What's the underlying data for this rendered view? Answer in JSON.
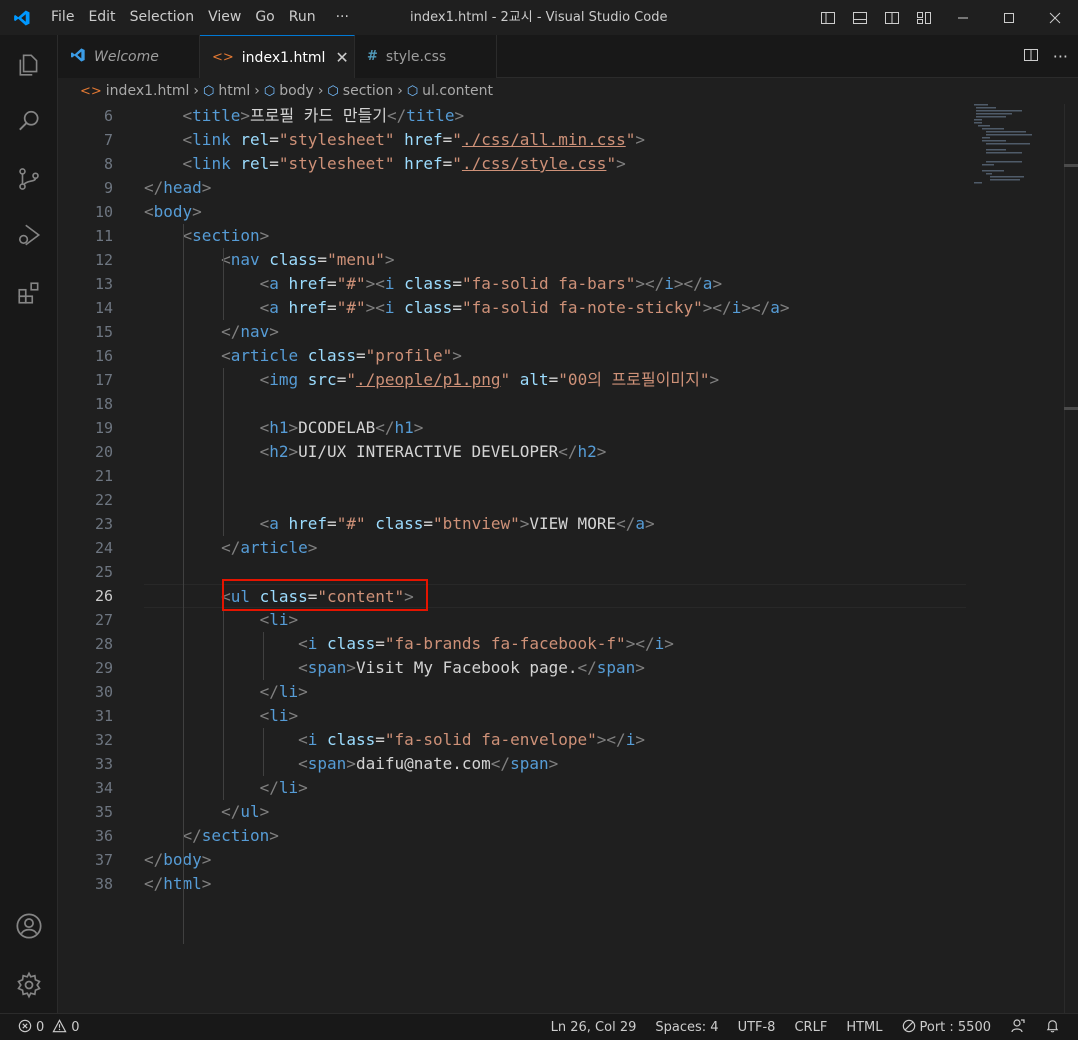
{
  "menu": [
    "File",
    "Edit",
    "Selection",
    "View",
    "Go",
    "Run",
    "···"
  ],
  "window_title": "index1.html - 2교시 - Visual Studio Code",
  "tabs": [
    {
      "label": "Welcome",
      "icon": "vscode-logo-icon",
      "italic": true,
      "active": false
    },
    {
      "label": "index1.html",
      "icon": "html-file-icon",
      "italic": false,
      "active": true
    },
    {
      "label": "style.css",
      "icon": "css-file-icon",
      "italic": false,
      "active": false
    }
  ],
  "breadcrumb": [
    "index1.html",
    "html",
    "body",
    "section",
    "ul.content"
  ],
  "lines": [
    {
      "n": "6",
      "html": "    <span class=\"punc\">&lt;</span><span class=\"tag\">title</span><span class=\"punc\">&gt;</span><span class=\"txt\">프로필 카드 만들기</span><span class=\"punc\">&lt;/</span><span class=\"tag\">title</span><span class=\"punc\">&gt;</span>"
    },
    {
      "n": "7",
      "html": "    <span class=\"punc\">&lt;</span><span class=\"tag\">link</span> <span class=\"attr\">rel</span><span class=\"txt\">=</span><span class=\"str\">\"stylesheet\"</span> <span class=\"attr\">href</span><span class=\"txt\">=</span><span class=\"str\">\"<span class=\"link\">./css/all.min.css</span>\"</span><span class=\"punc\">&gt;</span>"
    },
    {
      "n": "8",
      "html": "    <span class=\"punc\">&lt;</span><span class=\"tag\">link</span> <span class=\"attr\">rel</span><span class=\"txt\">=</span><span class=\"str\">\"stylesheet\"</span> <span class=\"attr\">href</span><span class=\"txt\">=</span><span class=\"str\">\"<span class=\"link\">./css/style.css</span>\"</span><span class=\"punc\">&gt;</span>"
    },
    {
      "n": "9",
      "html": "<span class=\"punc\">&lt;/</span><span class=\"tag\">head</span><span class=\"punc\">&gt;</span>"
    },
    {
      "n": "10",
      "html": "<span class=\"punc\">&lt;</span><span class=\"tag\">body</span><span class=\"punc\">&gt;</span>"
    },
    {
      "n": "11",
      "html": "    <span class=\"punc\">&lt;</span><span class=\"tag\">section</span><span class=\"punc\">&gt;</span>"
    },
    {
      "n": "12",
      "html": "        <span class=\"punc\">&lt;</span><span class=\"tag\">nav</span> <span class=\"attr\">class</span><span class=\"txt\">=</span><span class=\"str\">\"menu\"</span><span class=\"punc\">&gt;</span>"
    },
    {
      "n": "13",
      "html": "            <span class=\"punc\">&lt;</span><span class=\"tag\">a</span> <span class=\"attr\">href</span><span class=\"txt\">=</span><span class=\"str\">\"#\"</span><span class=\"punc\">&gt;&lt;</span><span class=\"tag\">i</span> <span class=\"attr\">class</span><span class=\"txt\">=</span><span class=\"str\">\"fa-solid fa-bars\"</span><span class=\"punc\">&gt;&lt;/</span><span class=\"tag\">i</span><span class=\"punc\">&gt;&lt;/</span><span class=\"tag\">a</span><span class=\"punc\">&gt;</span>"
    },
    {
      "n": "14",
      "html": "            <span class=\"punc\">&lt;</span><span class=\"tag\">a</span> <span class=\"attr\">href</span><span class=\"txt\">=</span><span class=\"str\">\"#\"</span><span class=\"punc\">&gt;&lt;</span><span class=\"tag\">i</span> <span class=\"attr\">class</span><span class=\"txt\">=</span><span class=\"str\">\"fa-solid fa-note-sticky\"</span><span class=\"punc\">&gt;&lt;/</span><span class=\"tag\">i</span><span class=\"punc\">&gt;&lt;/</span><span class=\"tag\">a</span><span class=\"punc\">&gt;</span>"
    },
    {
      "n": "15",
      "html": "        <span class=\"punc\">&lt;/</span><span class=\"tag\">nav</span><span class=\"punc\">&gt;</span>"
    },
    {
      "n": "16",
      "html": "        <span class=\"punc\">&lt;</span><span class=\"tag\">article</span> <span class=\"attr\">class</span><span class=\"txt\">=</span><span class=\"str\">\"profile\"</span><span class=\"punc\">&gt;</span>"
    },
    {
      "n": "17",
      "html": "            <span class=\"punc\">&lt;</span><span class=\"tag\">img</span> <span class=\"attr\">src</span><span class=\"txt\">=</span><span class=\"str\">\"<span class=\"link\">./people/p1.png</span>\"</span> <span class=\"attr\">alt</span><span class=\"txt\">=</span><span class=\"str\">\"00의 프로필이미지\"</span><span class=\"punc\">&gt;</span>"
    },
    {
      "n": "18",
      "html": ""
    },
    {
      "n": "19",
      "html": "            <span class=\"punc\">&lt;</span><span class=\"tag\">h1</span><span class=\"punc\">&gt;</span><span class=\"txt\">DCODELAB</span><span class=\"punc\">&lt;/</span><span class=\"tag\">h1</span><span class=\"punc\">&gt;</span>"
    },
    {
      "n": "20",
      "html": "            <span class=\"punc\">&lt;</span><span class=\"tag\">h2</span><span class=\"punc\">&gt;</span><span class=\"txt\">UI/UX INTERACTIVE DEVELOPER</span><span class=\"punc\">&lt;/</span><span class=\"tag\">h2</span><span class=\"punc\">&gt;</span>"
    },
    {
      "n": "21",
      "html": ""
    },
    {
      "n": "22",
      "html": ""
    },
    {
      "n": "23",
      "html": "            <span class=\"punc\">&lt;</span><span class=\"tag\">a</span> <span class=\"attr\">href</span><span class=\"txt\">=</span><span class=\"str\">\"#\"</span> <span class=\"attr\">class</span><span class=\"txt\">=</span><span class=\"str\">\"btnview\"</span><span class=\"punc\">&gt;</span><span class=\"txt\">VIEW MORE</span><span class=\"punc\">&lt;/</span><span class=\"tag\">a</span><span class=\"punc\">&gt;</span>"
    },
    {
      "n": "24",
      "html": "        <span class=\"punc\">&lt;/</span><span class=\"tag\">article</span><span class=\"punc\">&gt;</span>"
    },
    {
      "n": "25",
      "html": ""
    },
    {
      "n": "26",
      "html": "        <span class=\"punc\">&lt;</span><span class=\"tag\">ul</span> <span class=\"attr\">class</span><span class=\"txt\">=</span><span class=\"str\">\"content\"</span><span class=\"punc\">&gt;</span>",
      "current": true
    },
    {
      "n": "27",
      "html": "            <span class=\"punc\">&lt;</span><span class=\"tag\">li</span><span class=\"punc\">&gt;</span>"
    },
    {
      "n": "28",
      "html": "                <span class=\"punc\">&lt;</span><span class=\"tag\">i</span> <span class=\"attr\">class</span><span class=\"txt\">=</span><span class=\"str\">\"fa-brands fa-facebook-f\"</span><span class=\"punc\">&gt;&lt;/</span><span class=\"tag\">i</span><span class=\"punc\">&gt;</span>"
    },
    {
      "n": "29",
      "html": "                <span class=\"punc\">&lt;</span><span class=\"tag\">span</span><span class=\"punc\">&gt;</span><span class=\"txt\">Visit My Facebook page.</span><span class=\"punc\">&lt;/</span><span class=\"tag\">span</span><span class=\"punc\">&gt;</span>"
    },
    {
      "n": "30",
      "html": "            <span class=\"punc\">&lt;/</span><span class=\"tag\">li</span><span class=\"punc\">&gt;</span>"
    },
    {
      "n": "31",
      "html": "            <span class=\"punc\">&lt;</span><span class=\"tag\">li</span><span class=\"punc\">&gt;</span>"
    },
    {
      "n": "32",
      "html": "                <span class=\"punc\">&lt;</span><span class=\"tag\">i</span> <span class=\"attr\">class</span><span class=\"txt\">=</span><span class=\"str\">\"fa-solid fa-envelope\"</span><span class=\"punc\">&gt;&lt;/</span><span class=\"tag\">i</span><span class=\"punc\">&gt;</span>"
    },
    {
      "n": "33",
      "html": "                <span class=\"punc\">&lt;</span><span class=\"tag\">span</span><span class=\"punc\">&gt;</span><span class=\"txt\">daifu@nate.com</span><span class=\"punc\">&lt;/</span><span class=\"tag\">span</span><span class=\"punc\">&gt;</span>"
    },
    {
      "n": "34",
      "html": "            <span class=\"punc\">&lt;/</span><span class=\"tag\">li</span><span class=\"punc\">&gt;</span>"
    },
    {
      "n": "35",
      "html": "        <span class=\"punc\">&lt;/</span><span class=\"tag\">ul</span><span class=\"punc\">&gt;</span>"
    },
    {
      "n": "36",
      "html": "    <span class=\"punc\">&lt;/</span><span class=\"tag\">section</span><span class=\"punc\">&gt;</span>"
    },
    {
      "n": "37",
      "html": "<span class=\"punc\">&lt;/</span><span class=\"tag\">body</span><span class=\"punc\">&gt;</span>"
    },
    {
      "n": "38",
      "html": "<span class=\"punc\">&lt;/</span><span class=\"tag\">html</span><span class=\"punc\">&gt;</span>"
    }
  ],
  "status": {
    "errors": "0",
    "warnings": "0",
    "position": "Ln 26, Col 29",
    "spaces": "Spaces: 4",
    "encoding": "UTF-8",
    "eol": "CRLF",
    "language": "HTML",
    "port": "Port : 5500"
  },
  "colors": {
    "accent": "#0078d4",
    "highlight_box": "#e51400",
    "tag": "#569cd6",
    "attribute": "#9cdcfe",
    "string": "#ce9178"
  }
}
